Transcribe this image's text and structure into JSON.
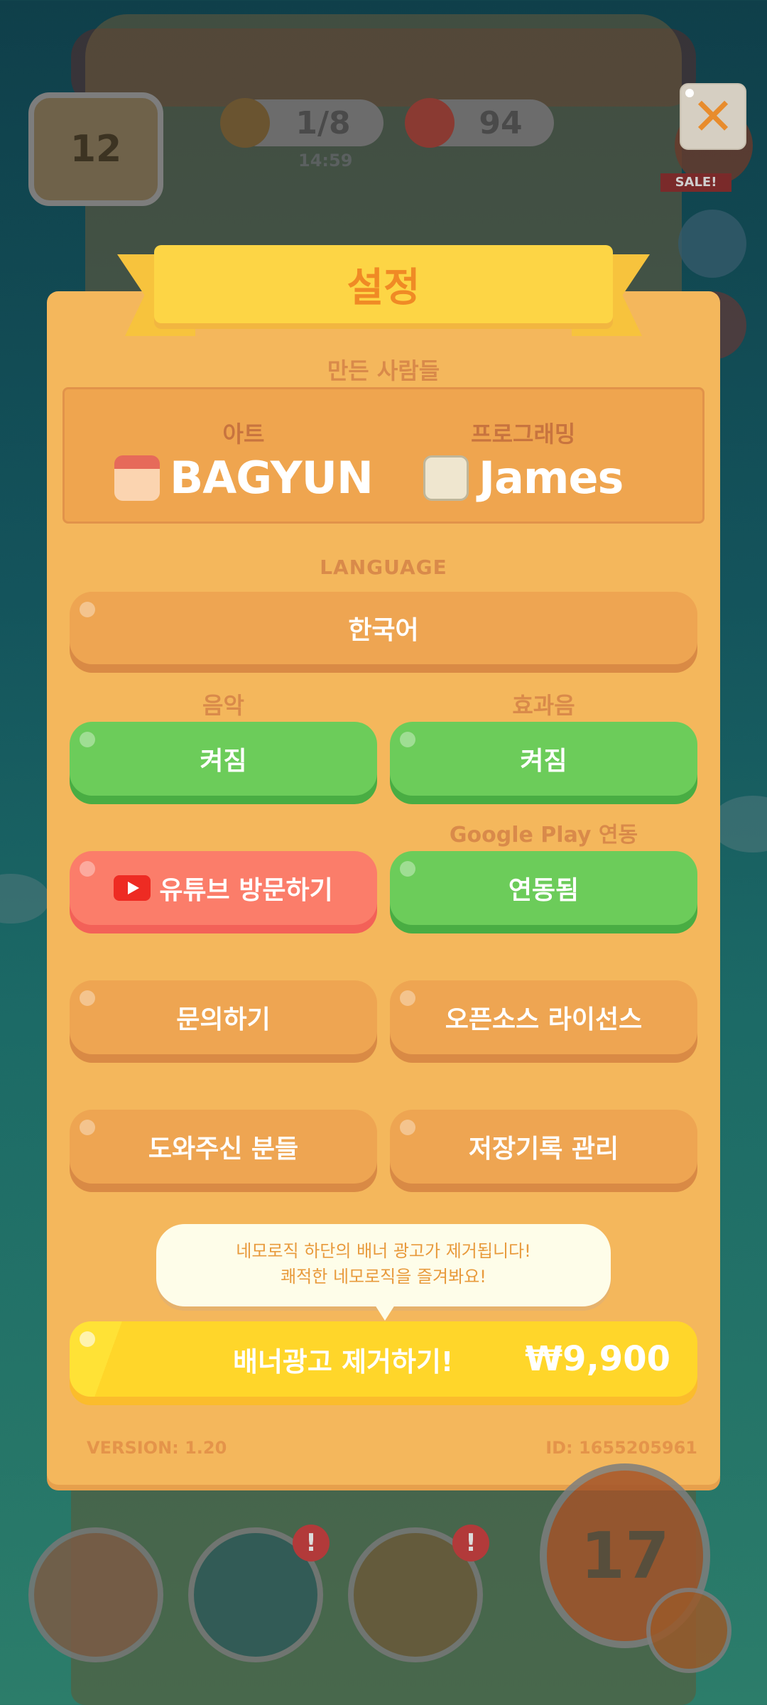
{
  "hud": {
    "house_level": "12",
    "pencils": "1/8",
    "timer": "14:59",
    "cans": "94",
    "sale_badge": "SALE!",
    "close_label": "✕"
  },
  "dialog": {
    "title": "설정",
    "credits_heading": "만든 사람들",
    "credits": [
      {
        "role": "아트",
        "name": "BAGYUN"
      },
      {
        "role": "프로그래밍",
        "name": "James"
      }
    ],
    "language_heading": "LANGUAGE",
    "language_button": "한국어",
    "music_heading": "음악",
    "music_button": "켜짐",
    "sfx_heading": "효과음",
    "sfx_button": "켜짐",
    "google_play_heading": "Google Play 연동",
    "youtube_button": "유튜브 방문하기",
    "google_play_button": "연동됨",
    "contact_button": "문의하기",
    "license_button": "오픈소스 라이선스",
    "helpers_button": "도와주신 분들",
    "save_button": "저장기록 관리",
    "tooltip_line1": "네모로직 하단의 배너 광고가 제거됩니다!",
    "tooltip_line2": "쾌적한 네모로직을 즐겨봐요!",
    "remove_ads_label": "배너광고 제거하기!",
    "remove_ads_price": "₩9,900",
    "version": "VERSION: 1.20",
    "id": "ID: 1655205961"
  },
  "bottom": {
    "level": "17",
    "alert": "!"
  },
  "colors": {
    "dialog_bg": "#f4b75c",
    "orange_button": "#eea552",
    "green_button": "#6ccc5a",
    "red_button": "#fb7d6a",
    "title_text": "#f08a25",
    "buy_button": "#ffd62a"
  }
}
